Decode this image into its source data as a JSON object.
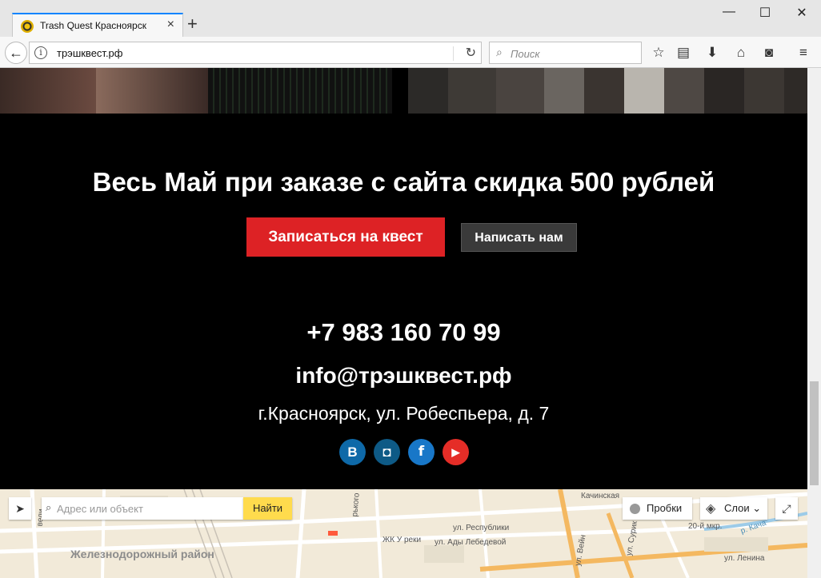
{
  "browser": {
    "tab_title": "Trash Quest Красноярск",
    "new_tab_icon": "+",
    "url": "трэшквест.рф",
    "search_placeholder": "Поиск"
  },
  "colors": {
    "accent_red": "#dd2225",
    "secondary_button": "#3a3a3a",
    "map_find": "#ffdb4d"
  },
  "promo": {
    "title": "Весь Май при заказе с сайта скидка 500 рублей",
    "book_button": "Записаться на квест",
    "write_button": "Написать нам"
  },
  "contacts": {
    "phone": "+7 983 160 70 99",
    "email": "info@трэшквест.рф",
    "address": "г.Красноярск, ул. Робеспьера, д. 7"
  },
  "social": [
    {
      "label": "B",
      "icon": "vk-icon",
      "color": "#0e69a8"
    },
    {
      "label": "◘",
      "icon": "instagram-icon",
      "color": "#0e5a86"
    },
    {
      "label": "f",
      "icon": "facebook-icon",
      "color": "#1877c8"
    },
    {
      "label": "▶",
      "icon": "youtube-icon",
      "color": "#e52d27"
    }
  ],
  "map": {
    "search_placeholder": "Адрес или объект",
    "find_button": "Найти",
    "traffic_button": "Пробки",
    "layers_button": "Слои",
    "district": "Железнодорожный район",
    "labels": {
      "street_respubliki": "ул. Республики",
      "street_ady_lebedevoy": "ул. Ады Лебедевой",
      "zhk_u_reki": "ЖК У реки",
      "kachinskaya": "Качинская",
      "twenty_mkr": "20-й мкр.",
      "lenina": "ул. Ленина",
      "vei": "ул. Вейн",
      "surik": "ул. Сурик",
      "kacha": "р. Кача",
      "gorkogo": "рького",
      "veli": "вели"
    }
  }
}
